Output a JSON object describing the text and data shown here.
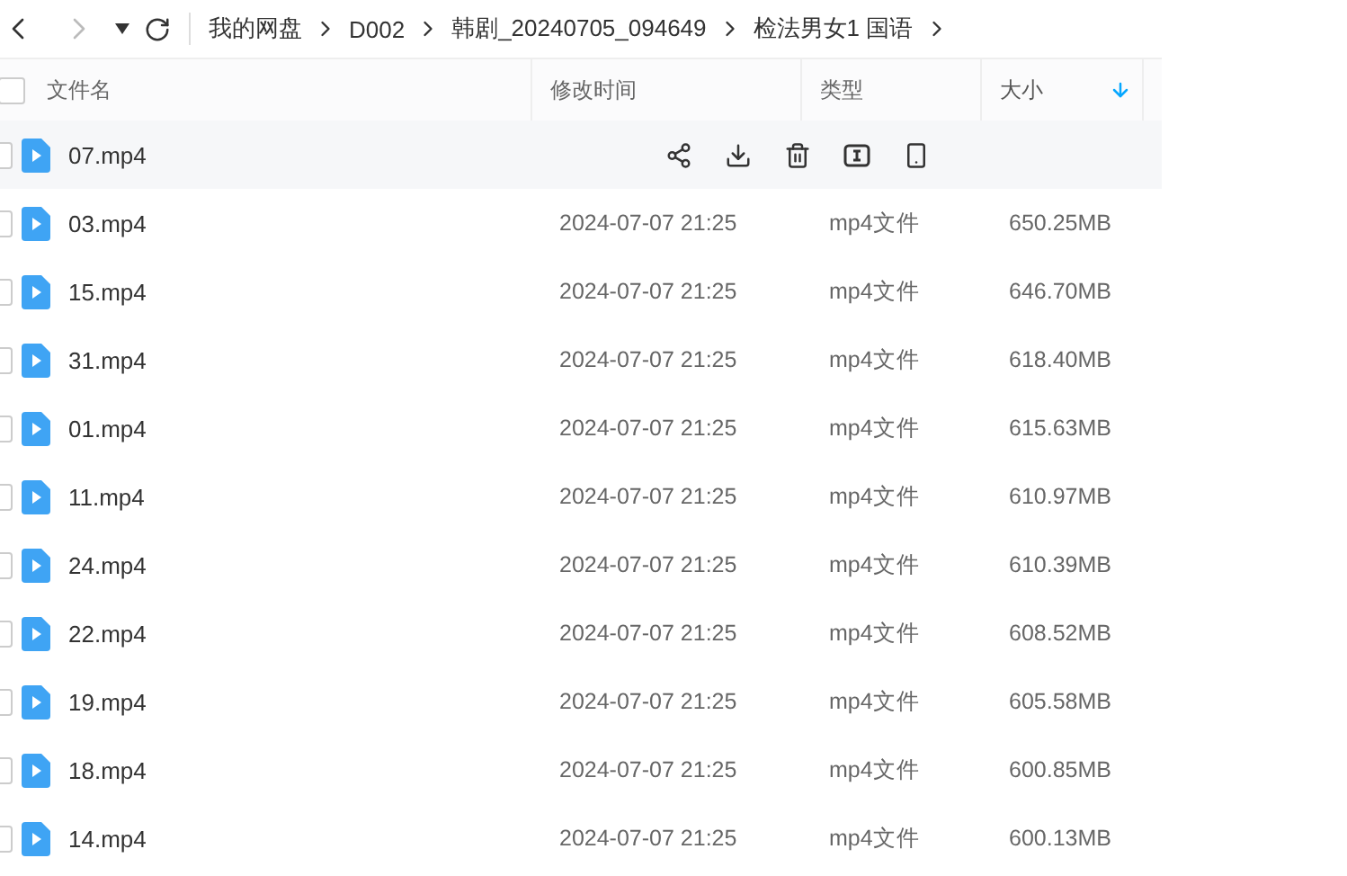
{
  "nav": {
    "back_disabled": false,
    "forward_disabled": true
  },
  "select_all_checked": false,
  "breadcrumb": [
    "我的网盘",
    "D002",
    "韩剧_20240705_094649",
    "检法男女1 国语"
  ],
  "columns": [
    {
      "label": "文件名",
      "sorted": false
    },
    {
      "label": "修改时间",
      "sorted": false
    },
    {
      "label": "类型",
      "sorted": false
    },
    {
      "label": "大小",
      "sorted": true
    }
  ],
  "rows": [
    {
      "name": "07.mp4",
      "hovered": true,
      "checked": false
    },
    {
      "name": "03.mp4",
      "modified": "2024-07-07 21:25",
      "type": "mp4文件",
      "size": "650.25MB",
      "hovered": false,
      "checked": false
    },
    {
      "name": "15.mp4",
      "modified": "2024-07-07 21:25",
      "type": "mp4文件",
      "size": "646.70MB",
      "hovered": false,
      "checked": false
    },
    {
      "name": "31.mp4",
      "modified": "2024-07-07 21:25",
      "type": "mp4文件",
      "size": "618.40MB",
      "hovered": false,
      "checked": false
    },
    {
      "name": "01.mp4",
      "modified": "2024-07-07 21:25",
      "type": "mp4文件",
      "size": "615.63MB",
      "hovered": false,
      "checked": false
    },
    {
      "name": "11.mp4",
      "modified": "2024-07-07 21:25",
      "type": "mp4文件",
      "size": "610.97MB",
      "hovered": false,
      "checked": false
    },
    {
      "name": "24.mp4",
      "modified": "2024-07-07 21:25",
      "type": "mp4文件",
      "size": "610.39MB",
      "hovered": false,
      "checked": false
    },
    {
      "name": "22.mp4",
      "modified": "2024-07-07 21:25",
      "type": "mp4文件",
      "size": "608.52MB",
      "hovered": false,
      "checked": false
    },
    {
      "name": "19.mp4",
      "modified": "2024-07-07 21:25",
      "type": "mp4文件",
      "size": "605.58MB",
      "hovered": false,
      "checked": false
    },
    {
      "name": "18.mp4",
      "modified": "2024-07-07 21:25",
      "type": "mp4文件",
      "size": "600.85MB",
      "hovered": false,
      "checked": false
    },
    {
      "name": "14.mp4",
      "modified": "2024-07-07 21:25",
      "type": "mp4文件",
      "size": "600.13MB",
      "hovered": false,
      "checked": false
    }
  ]
}
